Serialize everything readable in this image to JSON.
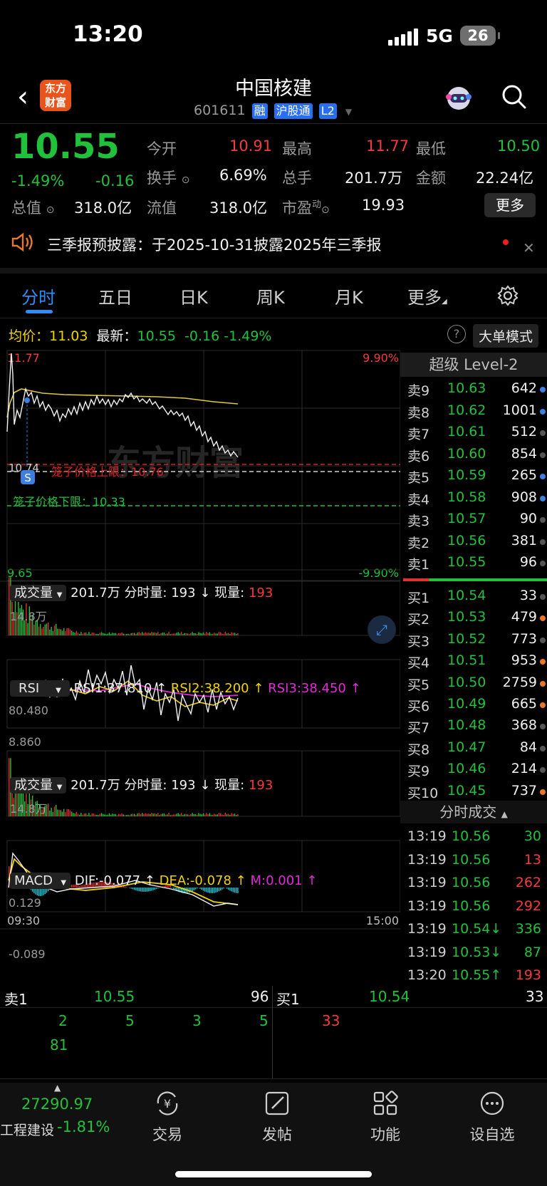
{
  "status": {
    "time": "13:20",
    "network": "5G",
    "battery": "26"
  },
  "header": {
    "logo_line1": "东方",
    "logo_line2": "财富",
    "title": "中国核建",
    "code": "601611",
    "tags": [
      "融",
      "沪股通",
      "L2"
    ]
  },
  "quote": {
    "price": "10.55",
    "pct": "-1.49%",
    "chg": "-0.16",
    "open_label": "今开",
    "open": "10.91",
    "high_label": "最高",
    "high": "11.77",
    "low_label": "最低",
    "low": "10.50",
    "turnover_label": "换手",
    "turnover": "6.69%",
    "vol_label": "总手",
    "vol": "201.7万",
    "amount_label": "金额",
    "amount": "22.24亿",
    "mktcap_label": "总值",
    "mktcap": "318.0亿",
    "float_label": "流值",
    "float": "318.0亿",
    "pe_label": "市盈",
    "pe_sup": "动",
    "pe": "19.93",
    "more": "更多"
  },
  "notice": {
    "text": "三季报预披露：于2025-10-31披露2025年三季报"
  },
  "tabs": [
    "分时",
    "五日",
    "日K",
    "周K",
    "月K",
    "更多"
  ],
  "intraday": {
    "avg_label": "均价：",
    "avg": "11.03",
    "latest_label": "最新：",
    "latest": "10.55",
    "chg": "-0.16",
    "pct": "-1.49%",
    "mode_btn": "大单模式",
    "y_top": "11.77",
    "y_bottom": "9.65",
    "pct_top": "9.90%",
    "pct_bottom": "-9.90%",
    "mid_label": "10.74",
    "cage_up": "笼子价格上限：10.76",
    "cage_down": "笼子价格下限：10.33",
    "badge": "S",
    "watermark": "东方财富",
    "time_start": "09:30",
    "time_end": "15:00"
  },
  "volume_panel": {
    "name": "成交量",
    "total": "201.7万",
    "min_label": "分时量: 193",
    "cur_label": "现量:",
    "cur": "193",
    "max": "14.8万"
  },
  "rsi_panel": {
    "name": "RSI",
    "rsi1": "RSI1:37.810 ↑",
    "rsi2": "RSI2:38.200 ↑",
    "rsi3": "RSI3:38.450 ↑",
    "max": "80.480",
    "min": "8.860"
  },
  "macd_panel": {
    "name": "MACD",
    "dif": "DIF:-0.077 ↑",
    "dea": "DEA:-0.078 ↑",
    "m": "M:0.001 ↑",
    "max": "0.129",
    "min": "-0.089"
  },
  "level2": {
    "title": "超级 Level-2",
    "asks": [
      {
        "label": "卖9",
        "price": "10.63",
        "vol": "642",
        "dot": "#3c7fe0"
      },
      {
        "label": "卖8",
        "price": "10.62",
        "vol": "1001",
        "dot": "#3c7fe0"
      },
      {
        "label": "卖7",
        "price": "10.61",
        "vol": "512",
        "dot": "#555555"
      },
      {
        "label": "卖6",
        "price": "10.60",
        "vol": "854",
        "dot": "#555555"
      },
      {
        "label": "卖5",
        "price": "10.59",
        "vol": "265",
        "dot": "#3c7fe0"
      },
      {
        "label": "卖4",
        "price": "10.58",
        "vol": "908",
        "dot": "#3c7fe0"
      },
      {
        "label": "卖3",
        "price": "10.57",
        "vol": "90",
        "dot": "#555555"
      },
      {
        "label": "卖2",
        "price": "10.56",
        "vol": "381",
        "dot": "#555555"
      },
      {
        "label": "卖1",
        "price": "10.55",
        "vol": "96",
        "dot": "#555555"
      }
    ],
    "bids": [
      {
        "label": "买1",
        "price": "10.54",
        "vol": "33",
        "dot": "#555555"
      },
      {
        "label": "买2",
        "price": "10.53",
        "vol": "479",
        "dot": "#e8762b"
      },
      {
        "label": "买3",
        "price": "10.52",
        "vol": "773",
        "dot": "#555555"
      },
      {
        "label": "买4",
        "price": "10.51",
        "vol": "953",
        "dot": "#e8762b"
      },
      {
        "label": "买5",
        "price": "10.50",
        "vol": "2759",
        "dot": "#e8762b"
      },
      {
        "label": "买6",
        "price": "10.49",
        "vol": "665",
        "dot": "#e8762b"
      },
      {
        "label": "买7",
        "price": "10.48",
        "vol": "368",
        "dot": "#555555"
      },
      {
        "label": "买8",
        "price": "10.47",
        "vol": "84",
        "dot": "#555555"
      },
      {
        "label": "买9",
        "price": "10.46",
        "vol": "214",
        "dot": "#555555"
      },
      {
        "label": "买10",
        "price": "10.45",
        "vol": "737",
        "dot": "#e8762b"
      }
    ]
  },
  "ticks": {
    "title": "分时成交",
    "rows": [
      {
        "time": "13:19",
        "price": "10.56",
        "vol": "30",
        "dir": ""
      },
      {
        "time": "13:19",
        "price": "10.56",
        "vol": "13",
        "dir": ""
      },
      {
        "time": "13:19",
        "price": "10.56",
        "vol": "262",
        "dir": ""
      },
      {
        "time": "13:19",
        "price": "10.56",
        "vol": "292",
        "dir": ""
      },
      {
        "time": "13:19",
        "price": "10.54↓",
        "vol": "336",
        "dir": "down"
      },
      {
        "time": "13:19",
        "price": "10.53↓",
        "vol": "87",
        "dir": "down"
      },
      {
        "time": "13:20",
        "price": "10.55↑",
        "vol": "193",
        "dir": "up"
      }
    ]
  },
  "bottom_book": {
    "sell_label": "卖1",
    "sell_price": "10.55",
    "sell_vol": "96",
    "buy_label": "买1",
    "buy_price": "10.54",
    "buy_vol": "33",
    "sell_queue": [
      "2",
      "5",
      "3",
      "5",
      "81"
    ],
    "buy_queue": [
      "33"
    ]
  },
  "bottom_nav": {
    "index_value": "27290.97",
    "index_name": "工程建设",
    "index_pct": "-1.81%",
    "items": [
      "交易",
      "发帖",
      "功能",
      "设自选"
    ]
  }
}
